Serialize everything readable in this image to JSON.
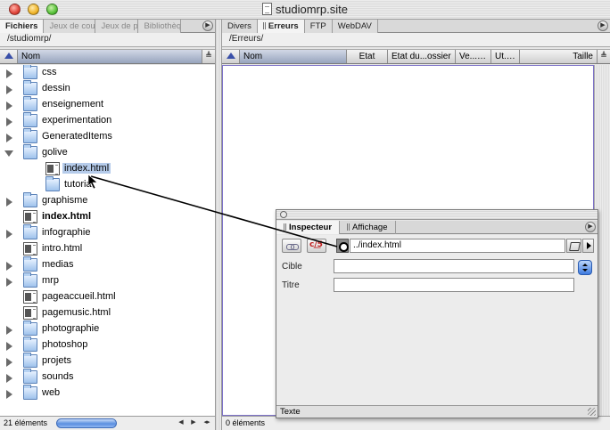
{
  "window": {
    "title": "studiomrp.site"
  },
  "left_pane": {
    "tabs": [
      {
        "label": "Fichiers",
        "active": true
      },
      {
        "label": "Jeux de couleurs",
        "active": false
      },
      {
        "label": "Jeux de polices",
        "active": false
      },
      {
        "label": "Bibliothèque",
        "active": false
      }
    ],
    "path": "/studiomrp/",
    "column": "Nom",
    "items": [
      {
        "name": "css",
        "type": "folder",
        "expanded": false,
        "level": 0
      },
      {
        "name": "dessin",
        "type": "folder",
        "expanded": false,
        "level": 0
      },
      {
        "name": "enseignement",
        "type": "folder",
        "expanded": false,
        "level": 0
      },
      {
        "name": "experimentation",
        "type": "folder",
        "expanded": false,
        "level": 0
      },
      {
        "name": "GeneratedItems",
        "type": "folder",
        "expanded": false,
        "level": 0
      },
      {
        "name": "golive",
        "type": "folder",
        "expanded": true,
        "level": 0
      },
      {
        "name": "index.html",
        "type": "html",
        "level": 1,
        "selected": true
      },
      {
        "name": "tutorial",
        "type": "folder",
        "expanded": false,
        "level": 1
      },
      {
        "name": "graphisme",
        "type": "folder",
        "expanded": false,
        "level": 0
      },
      {
        "name": "index.html",
        "type": "html",
        "level": 0,
        "bold": true
      },
      {
        "name": "infographie",
        "type": "folder",
        "expanded": false,
        "level": 0
      },
      {
        "name": "intro.html",
        "type": "html",
        "level": 0
      },
      {
        "name": "medias",
        "type": "folder",
        "expanded": false,
        "level": 0
      },
      {
        "name": "mrp",
        "type": "folder",
        "expanded": false,
        "level": 0
      },
      {
        "name": "pageaccueil.html",
        "type": "html",
        "level": 0
      },
      {
        "name": "pagemusic.html",
        "type": "html",
        "level": 0
      },
      {
        "name": "photographie",
        "type": "folder",
        "expanded": false,
        "level": 0
      },
      {
        "name": "photoshop",
        "type": "folder",
        "expanded": false,
        "level": 0
      },
      {
        "name": "projets",
        "type": "folder",
        "expanded": false,
        "level": 0
      },
      {
        "name": "sounds",
        "type": "folder",
        "expanded": false,
        "level": 0
      },
      {
        "name": "web",
        "type": "folder",
        "expanded": false,
        "level": 0
      }
    ],
    "status": "21 éléments"
  },
  "right_pane": {
    "tabs": [
      {
        "label": "Divers",
        "active": false
      },
      {
        "label": "Erreurs",
        "active": true
      },
      {
        "label": "FTP",
        "active": false
      },
      {
        "label": "WebDAV",
        "active": false
      }
    ],
    "path": "/Erreurs/",
    "columns": [
      "Nom",
      "Etat",
      "Etat du...ossier",
      "Ve...ge",
      "Ut...é",
      "Taille"
    ],
    "status": "0 éléments"
  },
  "inspector": {
    "tabs": [
      {
        "label": "Inspecteur",
        "active": true
      },
      {
        "label": "Affichage",
        "active": false
      }
    ],
    "url": "../index.html",
    "labels": {
      "target": "Cible",
      "title": "Titre"
    },
    "target_value": "",
    "title_value": "",
    "footer": "Texte"
  },
  "icons": {
    "sort": "sort-ascending-icon",
    "folder": "folder-icon",
    "html": "html-file-icon",
    "link": "link-icon",
    "point": "point-and-shoot-icon",
    "browse": "browse-folder-icon"
  },
  "colors": {
    "selection": "#b5cbea",
    "sort_header": "#97a4bd",
    "accent": "#3d7ae0"
  }
}
